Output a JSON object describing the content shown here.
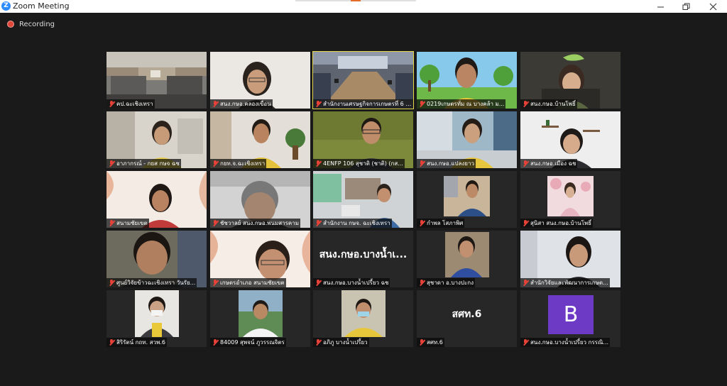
{
  "window": {
    "title": "Zoom Meeting",
    "logo_letter": "Z"
  },
  "recording": {
    "label": "Recording"
  },
  "participants": [
    {
      "name": "คป.ฉะเชิงเทรา"
    },
    {
      "name": "สนง.กษอ.คลองเขื่อน"
    },
    {
      "name": "สำนักงานเศรษฐกิจการเกษตรที่ 6 ม..."
    },
    {
      "name": "0219เกษตรทั่ม ณ บางคล้า ม..."
    },
    {
      "name": "สนง.กษอ.บ้านโพธิ์"
    },
    {
      "name": "อาภากรณ์ - กยส กษจ ฉช"
    },
    {
      "name": "กยท.จ.ฉะเชิงเทรา"
    },
    {
      "name": "4ENFP 106 สุชาติ (ชาติ) (กส..."
    },
    {
      "name": "สนง.กษอ.แปลงยาว"
    },
    {
      "name": "สนง.กษอ.เมือง ฉช"
    },
    {
      "name": "สนามชัยเขต"
    },
    {
      "name": "ชัชวาลย์ สนง.กษอ.พนมสารคาม"
    },
    {
      "name": "สำนักงาน กษจ. ฉะเชิงเทรา"
    },
    {
      "name": "กำพล โสภาพิศ"
    },
    {
      "name": "สุนิสา สนง.กษอ.บ้านโพธิ์"
    },
    {
      "name": "ศูนย์วิจัยข้าวฉะเชิงเทรา วันรัย..."
    },
    {
      "name": "เกษตรอำเภอ สนามชัยเขต"
    },
    {
      "name": "สนง.กษอ.บางน้ำเปรี้ยว ฉช",
      "display_text": "สนง.กษอ.บางน้ำเ..."
    },
    {
      "name": "สุชาดา อ.บางปะกง"
    },
    {
      "name": "สำนักวิจัยและพัฒนาการเกษต..."
    },
    {
      "name": "สิริรัตน์ กถท. สวพ.6"
    },
    {
      "name": "84009 สุพจน์ ภูวรรณจิตร"
    },
    {
      "name": "อภิภู บางน้ำเปรี้ยว"
    },
    {
      "name": "สศท.6",
      "display_text": "สศท.6"
    },
    {
      "name": "สนง.กษอ.บางน้ำเปรี้ยว กรรณิ...",
      "avatar_letter": "B"
    }
  ],
  "icons": {
    "recording": "recording-dot-icon",
    "muted": "mic-muted-icon",
    "close": "close-icon",
    "minimize": "minimize-icon",
    "maximize": "maximize-icon"
  }
}
